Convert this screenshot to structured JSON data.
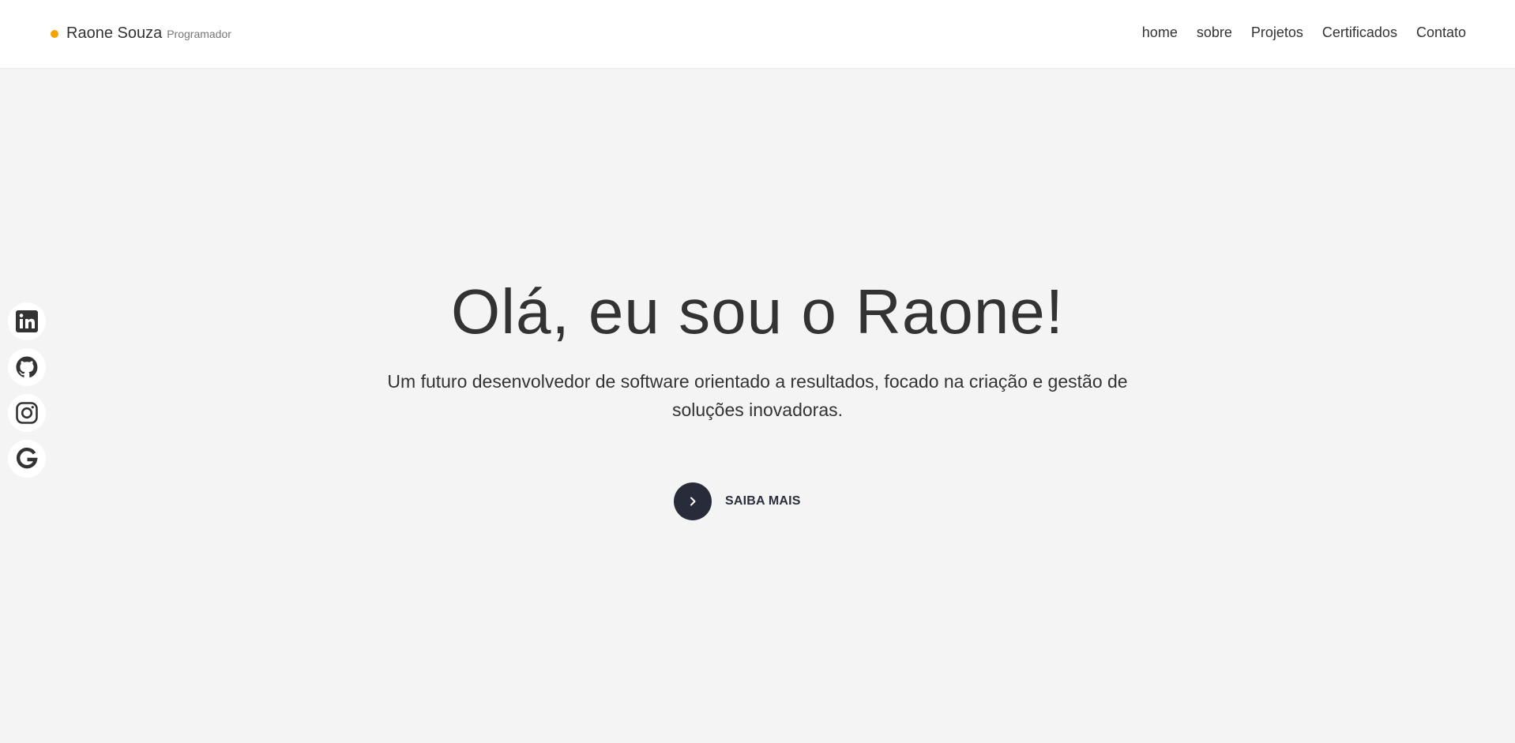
{
  "colors": {
    "accent": "#f5a300",
    "dark": "#282b3a",
    "icon": "#333333",
    "background": "#f4f4f4"
  },
  "brand": {
    "name": "Raone Souza",
    "role": "Programador"
  },
  "nav": {
    "items": [
      {
        "label": "home"
      },
      {
        "label": "sobre"
      },
      {
        "label": "Projetos"
      },
      {
        "label": "Certificados"
      },
      {
        "label": "Contato"
      }
    ]
  },
  "social": {
    "icons": [
      "linkedin-icon",
      "github-icon",
      "instagram-icon",
      "google-icon"
    ]
  },
  "hero": {
    "title": "Olá, eu sou o Raone!",
    "subtitle": "Um futuro desenvolvedor de software orientado a resultados, focado na criação e gestão de soluções inovadoras.",
    "cta_label": "SAIBA MAIS",
    "cta_icon": "chevron-right-icon"
  }
}
